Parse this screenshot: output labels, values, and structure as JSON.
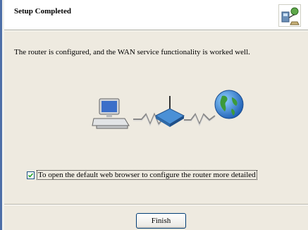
{
  "header": {
    "title": "Setup Completed",
    "icon": "setup-wizard-icon"
  },
  "main": {
    "message": "The router is configured, and the WAN service functionality is worked well.",
    "illustration": {
      "icons": [
        "computer-icon",
        "router-icon",
        "globe-icon"
      ]
    },
    "checkbox": {
      "label": "To open the default web browser to configure the router more detailed",
      "checked": true
    }
  },
  "footer": {
    "finish_label": "Finish"
  },
  "colors": {
    "body_bg": "#eeeae0",
    "left_edge": "#4d6fa8",
    "button_border": "#003c74"
  }
}
